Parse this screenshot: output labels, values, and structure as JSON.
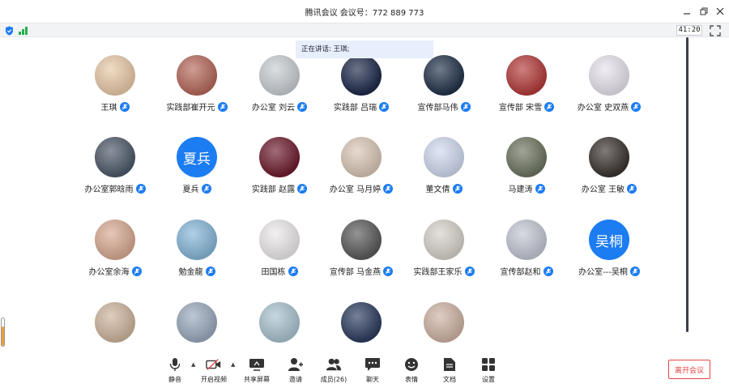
{
  "window": {
    "title": "腾讯会议 会议号：772 889 773",
    "minimize_icon": "minimize-icon",
    "restore_icon": "restore-icon",
    "close_icon": "close-icon"
  },
  "status": {
    "elapsed": "41:20",
    "accent": "#1c7cf2",
    "signal_color": "#22b14c"
  },
  "speaker_banner": "正在讲话: 王琪;",
  "participants": [
    {
      "name": "王琪",
      "mic": "mic-icon",
      "avatar_color": "#e8c9a8"
    },
    {
      "name": "实践部崔开元",
      "mic": "mic-icon",
      "avatar_color": "#b5685a"
    },
    {
      "name": "办公室 刘云",
      "mic": "mic-icon",
      "avatar_color": "#c9cdd2"
    },
    {
      "name": "实践部 吕瑞",
      "mic": "mic-icon",
      "avatar_color": "#1e2a4a"
    },
    {
      "name": "宣传部马伟",
      "mic": "mic-icon",
      "avatar_color": "#23324a"
    },
    {
      "name": "宣传部  宋雪",
      "mic": "mic-icon",
      "avatar_color": "#b33b3b"
    },
    {
      "name": "办公室 史双燕",
      "mic": "mic-icon",
      "avatar_color": "#e7e3ee"
    },
    {
      "name": "办公室郭晗雨",
      "mic": "mic-icon",
      "avatar_color": "#4d5868"
    },
    {
      "name": "夏兵",
      "mic": "mic-icon",
      "avatar_text": "夏兵",
      "avatar_color": "#1c7cf2"
    },
    {
      "name": "实践部   赵露",
      "mic": "mic-icon",
      "avatar_color": "#6e1d2e"
    },
    {
      "name": "办公室 马月婷",
      "mic": "mic-icon",
      "avatar_color": "#d9c6b6"
    },
    {
      "name": "董文倩",
      "mic": "mic-icon",
      "avatar_color": "#cfd9ee"
    },
    {
      "name": "马建涛",
      "mic": "mic-icon",
      "avatar_color": "#6d7460"
    },
    {
      "name": "办公室 王敏",
      "mic": "mic-icon",
      "avatar_color": "#3b3430"
    },
    {
      "name": "办公室余海",
      "mic": "mic-icon",
      "avatar_color": "#d8a992"
    },
    {
      "name": "勉金龍",
      "mic": "mic-icon",
      "avatar_color": "#86b6d8"
    },
    {
      "name": "田国栋",
      "mic": "mic-icon",
      "avatar_color": "#ece9ea"
    },
    {
      "name": "宣传部 马金燕",
      "mic": "mic-icon",
      "avatar_color": "#5a5a5a"
    },
    {
      "name": "实践部王家乐",
      "mic": "mic-icon",
      "avatar_color": "#d6d1c9"
    },
    {
      "name": "宣传部赵和",
      "mic": "mic-icon",
      "avatar_color": "#c3c7d3"
    },
    {
      "name": "办公室---吴桐",
      "mic": "mic-icon",
      "avatar_text": "吴桐",
      "avatar_color": "#1c7cf2"
    },
    {
      "name": "",
      "avatar_color": "#cdb49c"
    },
    {
      "name": "",
      "avatar_color": "#9aa9bd"
    },
    {
      "name": "",
      "avatar_color": "#a9c2cf"
    },
    {
      "name": "",
      "avatar_color": "#2d3c5e"
    },
    {
      "name": "",
      "avatar_color": "#ceb2a3"
    }
  ],
  "toolbar": {
    "mute": "静音",
    "video": "开启视频",
    "share": "共享屏幕",
    "invite": "邀请",
    "members": "成员(26)",
    "chat": "聊天",
    "emoji": "表情",
    "docs": "文档",
    "settings": "设置",
    "leave": "离开会议"
  }
}
